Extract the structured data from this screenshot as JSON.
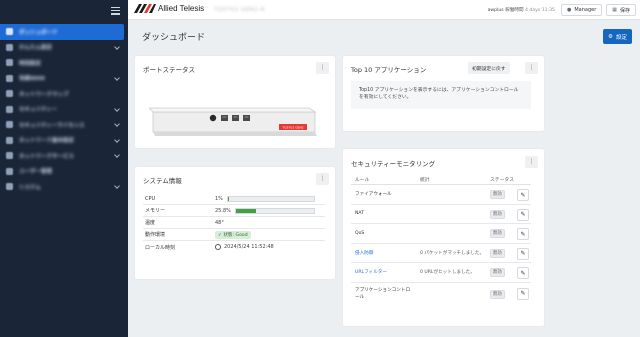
{
  "sidebar": {
    "items": [
      {
        "label": "ダッシュボード",
        "icon": "dashboard-icon",
        "active": true
      },
      {
        "label": "かんたん設定",
        "icon": "wand-icon",
        "chevron": true
      },
      {
        "label": "時刻設定",
        "icon": "clock-icon"
      },
      {
        "label": "有線WAN",
        "icon": "network-icon",
        "chevron": true
      },
      {
        "label": "ネットワークマップ",
        "icon": "map-icon"
      },
      {
        "label": "セキュリティー",
        "icon": "shield-icon",
        "chevron": true
      },
      {
        "label": "セキュリティーライセンス",
        "icon": "license-icon",
        "chevron": true
      },
      {
        "label": "ネットワーク基本設定",
        "icon": "gear-icon",
        "chevron": true
      },
      {
        "label": "ネットワークサービス",
        "icon": "services-icon",
        "chevron": true
      },
      {
        "label": "ユーザー管理",
        "icon": "users-icon"
      },
      {
        "label": "システム",
        "icon": "system-icon",
        "chevron": true
      }
    ]
  },
  "header": {
    "brand": "Allied Telesis",
    "device_name": "TQ5702 GEN2-R",
    "user": "awplus",
    "uptime_label": "稼働時間",
    "uptime_value": "4 days 11:35",
    "manager_label": "Manager",
    "save_label": "保存"
  },
  "page": {
    "title": "ダッシュボード",
    "settings_label": "設定"
  },
  "port_status": {
    "title": "ポートステータス",
    "device_label": "TQ5702 GEN2"
  },
  "system_info": {
    "title": "システム情報",
    "rows": [
      {
        "key": "CPU",
        "value": "1%",
        "percent": 1
      },
      {
        "key": "メモリー",
        "value": "25.8%",
        "percent": 25.8
      },
      {
        "key": "温度",
        "value": "48°"
      },
      {
        "key": "動作環境",
        "value": "状態: Good"
      },
      {
        "key": "ローカル時刻",
        "value": "2024/5/24 11:52:48"
      }
    ]
  },
  "top_apps": {
    "title": "Top 10 アプリケーション",
    "reset_label": "初期設定に戻す",
    "message": "Top10 アプリケーションを表示するには、アプリケーションコントロールを有効にしてください。"
  },
  "security": {
    "title": "セキュリティーモニタリング",
    "columns": [
      "ルール",
      "統計",
      "ステータス"
    ],
    "rows": [
      {
        "rule": "ファイアウォール",
        "stat": "",
        "status": "無効",
        "link": false
      },
      {
        "rule": "NAT",
        "stat": "",
        "status": "無効",
        "link": false
      },
      {
        "rule": "QoS",
        "stat": "",
        "status": "無効",
        "link": false
      },
      {
        "rule": "侵入防御",
        "stat": "0 パケットがマッチしました。",
        "status": "無効",
        "link": true
      },
      {
        "rule": "URLフィルター",
        "stat": "0 URLがヒットしました。",
        "status": "無効",
        "link": true
      },
      {
        "rule": "アプリケーションコントロール",
        "stat": "",
        "status": "無効",
        "link": false
      }
    ]
  },
  "colors": {
    "sidebar_bg": "#1a2538",
    "active_nav": "#1e6bd6",
    "primary_button": "#1566c0",
    "memory_bar": "#43a047",
    "device_label_bg": "#e53935"
  }
}
